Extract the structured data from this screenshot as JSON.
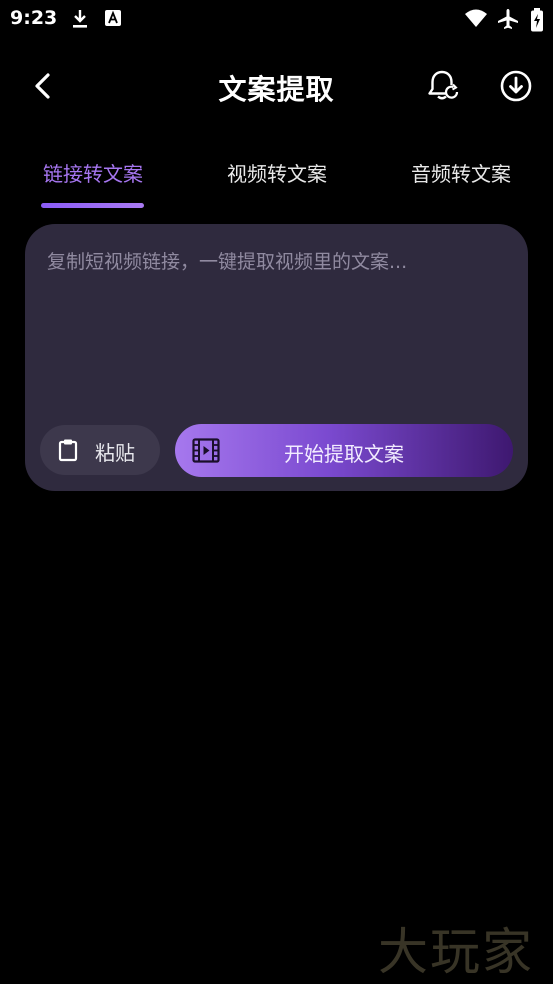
{
  "status_bar": {
    "time": "9:23"
  },
  "header": {
    "title": "文案提取"
  },
  "tabs": [
    {
      "label": "链接转文案",
      "active": true
    },
    {
      "label": "视频转文案",
      "active": false
    },
    {
      "label": "音频转文案",
      "active": false
    }
  ],
  "card": {
    "input_value": "",
    "input_placeholder": "复制短视频链接，一键提取视频里的文案...",
    "paste_label": "粘贴",
    "start_label": "开始提取文案"
  },
  "watermark": "大玩家",
  "colors": {
    "accent": "#a676f0",
    "card_bg": "#2f2a3e",
    "background": "#000000"
  },
  "icons": {
    "back": "chevron-left-icon",
    "bell": "bell-refresh-icon",
    "download": "download-circle-icon",
    "paste": "clipboard-icon",
    "start": "film-icon"
  }
}
